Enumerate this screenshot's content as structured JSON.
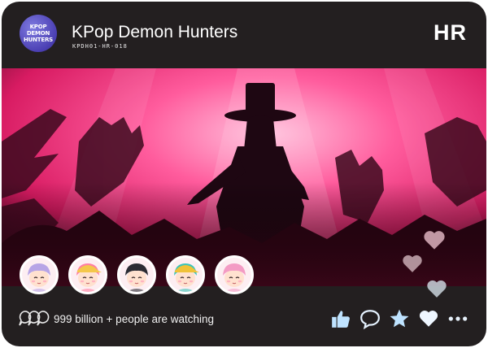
{
  "header": {
    "logo_text": "KPOP DEMON HUNTERS",
    "title": "KPop Demon Hunters",
    "card_code": "KPDH01-HR-018",
    "rarity": "HR"
  },
  "members": [
    {
      "hair": "#b7a4e6",
      "cap": null
    },
    {
      "hair": "#ff7ea2",
      "cap": "#f4c74a"
    },
    {
      "hair": "#2b2b33",
      "cap": null
    },
    {
      "hair": "#3dc4b8",
      "cap": "#f0c238"
    },
    {
      "hair": "#f39bc4",
      "cap": null
    }
  ],
  "footer": {
    "watching_text": "999 billion + people are watching"
  },
  "actions": [
    "like-icon",
    "comment-icon",
    "star-icon",
    "heart-icon",
    "more-icon"
  ],
  "colors": {
    "card_bg": "#231f20",
    "scene_pink": "#ff3a86",
    "scene_deep": "#7a0f3a",
    "icon_blue": "#bfe3ff"
  }
}
